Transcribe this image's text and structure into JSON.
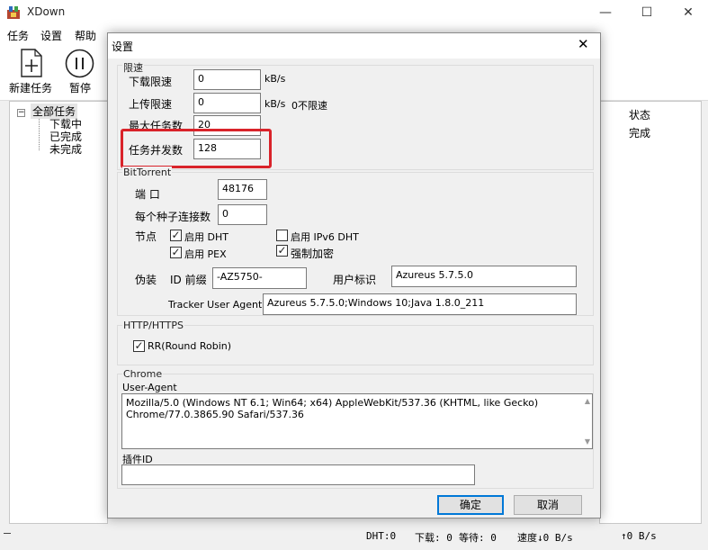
{
  "app": {
    "title": "XDown"
  },
  "menu": [
    "任务",
    "设置",
    "帮助"
  ],
  "toolbar": {
    "new_task": "新建任务",
    "pause": "暂停"
  },
  "tree": {
    "root": "全部任务",
    "children": [
      "下载中",
      "已完成",
      "未完成"
    ]
  },
  "list": {
    "status_header": "状态",
    "status_value": "完成"
  },
  "statusbar": {
    "dht": "DHT:0",
    "download": "下载: 0",
    "waiting": "等待: 0",
    "speed": "速度↓0 B/s",
    "upload": "↑0 B/s"
  },
  "dialog": {
    "title": "设置",
    "rate_limit": {
      "group_label": "限速",
      "download_label": "下载限速",
      "download_value": "0",
      "download_unit": "kB/s",
      "upload_label": "上传限速",
      "upload_value": "0",
      "upload_unit": "kB/s",
      "upload_hint": "0不限速",
      "max_tasks_label": "最大任务数",
      "max_tasks_value": "20",
      "concurrency_label": "任务并发数",
      "concurrency_value": "128"
    },
    "bittorrent": {
      "group_label": "BitTorrent",
      "port_label": "端 口",
      "port_value": "48176",
      "conn_label": "每个种子连接数",
      "conn_value": "0",
      "node_label": "节点",
      "dht_label": "启用 DHT",
      "dht_checked": true,
      "ipv6_label": "启用 IPv6 DHT",
      "ipv6_checked": false,
      "pex_label": "启用 PEX",
      "pex_checked": true,
      "encrypt_label": "强制加密",
      "encrypt_checked": true,
      "disguise_label": "伪装",
      "id_prefix_label": "ID 前缀",
      "id_prefix_value": "-AZ5750-",
      "user_id_label": "用户标识",
      "user_id_value": "Azureus 5.7.5.0",
      "tracker_ua_label": "Tracker User Agent",
      "tracker_ua_value": "Azureus 5.7.5.0;Windows 10;Java 1.8.0_211"
    },
    "http": {
      "group_label": "HTTP/HTTPS",
      "rr_label": "RR(Round Robin)",
      "rr_checked": true
    },
    "chrome": {
      "group_label": "Chrome",
      "ua_label": "User-Agent",
      "ua_line1": "Mozilla/5.0 (Windows NT 6.1; Win64; x64) AppleWebKit/537.36 (KHTML, like Gecko)",
      "ua_line2": "Chrome/77.0.3865.90 Safari/537.36",
      "plugin_id_label": "插件ID",
      "plugin_id_value": ""
    },
    "ok_label": "确定",
    "cancel_label": "取消"
  },
  "colors": {
    "highlight": "#d9232a",
    "default_button_border": "#0078d7"
  }
}
